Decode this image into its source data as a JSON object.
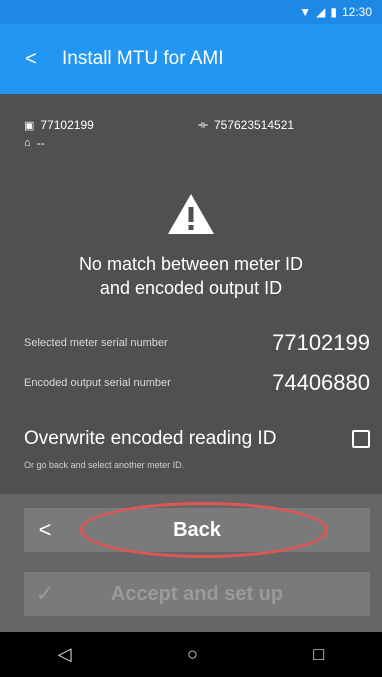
{
  "status_bar": {
    "time": "12:30",
    "wifi_icon": "wifi-icon",
    "signal_icon": "signal-icon",
    "battery_icon": "battery-icon"
  },
  "app_bar": {
    "back_icon": "back-arrow-icon",
    "title": "Install MTU for AMI"
  },
  "meter": {
    "serial": "77102199",
    "port_id": "757623514521",
    "address": "--"
  },
  "alert": {
    "icon": "warning-icon",
    "message_line1": "No match between meter ID",
    "message_line2": "and encoded output ID"
  },
  "details": {
    "selected_label": "Selected meter serial number",
    "selected_value": "77102199",
    "encoded_label": "Encoded output serial number",
    "encoded_value": "74406880"
  },
  "overwrite": {
    "label": "Overwrite encoded reading ID",
    "hint": "Or go back and select another meter ID.",
    "checked": false
  },
  "buttons": {
    "back_label": "Back",
    "accept_label": "Accept and set up"
  },
  "colors": {
    "accent": "#2196f3",
    "highlight": "#e05555"
  }
}
